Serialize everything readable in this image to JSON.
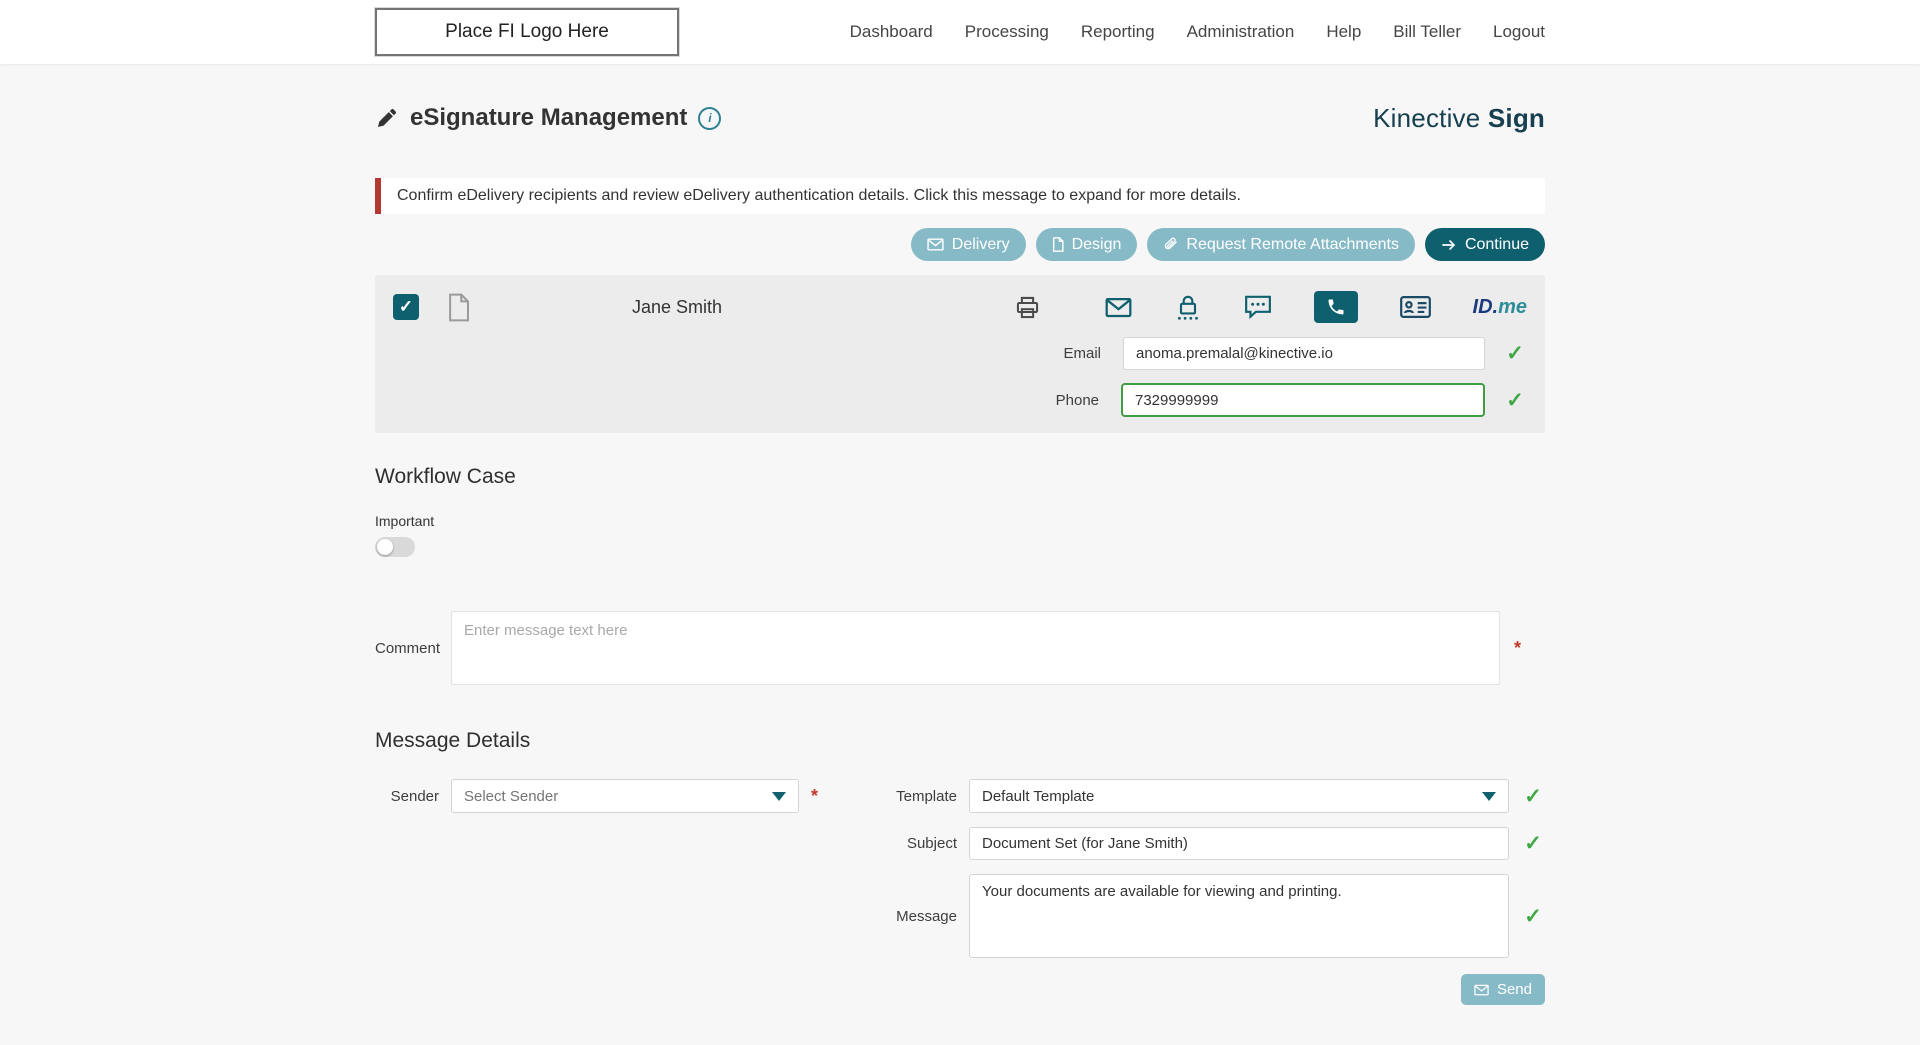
{
  "colors": {
    "dark_teal": "#0f606e",
    "light_teal": "#87bac7",
    "success_green": "#3fa845",
    "alert_red": "#b03a33",
    "brand_navy": "#16404f",
    "card_gray": "#ececec"
  },
  "header": {
    "logo_placeholder": "Place FI Logo Here",
    "nav": [
      {
        "label": "Dashboard"
      },
      {
        "label": "Processing"
      },
      {
        "label": "Reporting"
      },
      {
        "label": "Administration"
      },
      {
        "label": "Help"
      },
      {
        "label": "Bill Teller"
      },
      {
        "label": "Logout"
      }
    ]
  },
  "page": {
    "title": "eSignature Management",
    "brand_name": "Kinective",
    "brand_product": "Sign",
    "alert_message": "Confirm eDelivery recipients and review eDelivery authentication details. Click this message to expand for more details."
  },
  "toolbar": {
    "delivery_label": "Delivery",
    "design_label": "Design",
    "request_remote_attachments_label": "Request Remote Attachments",
    "continue_label": "Continue"
  },
  "recipient": {
    "name": "Jane Smith",
    "email_label": "Email",
    "email_value": "anoma.premalal@kinective.io",
    "phone_label": "Phone",
    "phone_value": "7329999999",
    "idme_id": "ID.",
    "idme_me": "me"
  },
  "workflow_case": {
    "heading": "Workflow Case",
    "important_label": "Important",
    "comment_label": "Comment",
    "comment_placeholder": "Enter message text here"
  },
  "message_details": {
    "heading": "Message Details",
    "sender_label": "Sender",
    "sender_value": "Select Sender",
    "template_label": "Template",
    "template_value": "Default Template",
    "subject_label": "Subject",
    "subject_value": "Document Set (for Jane Smith)",
    "message_label": "Message",
    "message_value": "Your documents are available for viewing and printing.",
    "send_label": "Send"
  },
  "glyphs": {
    "check": "✓",
    "required": "*",
    "info": "i"
  }
}
